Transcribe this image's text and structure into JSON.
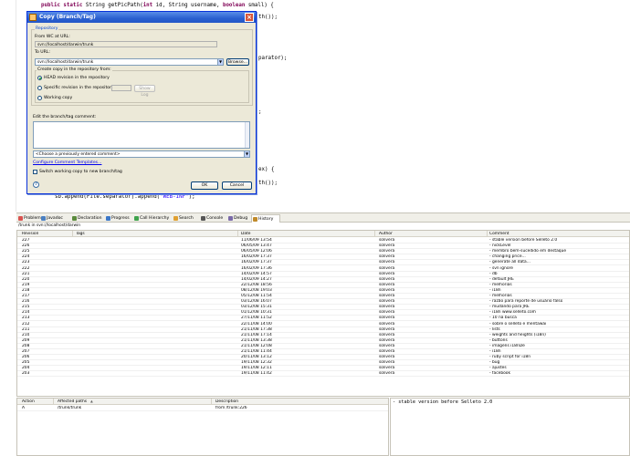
{
  "editor": {
    "lines": [
      {
        "segments": [
          {
            "t": "public static",
            "k": "kw"
          },
          {
            "t": " String getPicPath("
          },
          {
            "t": "int",
            "k": "kw"
          },
          {
            "t": " id, String username, "
          },
          {
            "t": "boolean",
            "k": "kw"
          },
          {
            "t": " small) {"
          }
        ]
      },
      {
        "segments": [
          {
            "t": "th());"
          }
        ]
      },
      {
        "segments": [
          {
            "t": "parator);"
          }
        ]
      },
      {
        "segments": [
          {
            "t": ";"
          }
        ]
      },
      {
        "segments": [
          {
            "t": "ex) {"
          }
        ]
      },
      {
        "segments": [
          {
            "t": "th());"
          }
        ]
      },
      {
        "segments": [
          {
            "t": "sb.append(File.separator).append("
          },
          {
            "t": "\"WEB-INF\"",
            "k": "str"
          },
          {
            "t": ");"
          }
        ]
      }
    ]
  },
  "dialog": {
    "title": "Copy (Branch/Tag)",
    "repository_group": "Repository",
    "from_label": "From WC at URL:",
    "from_value": "svn://localhost/darwin/trunk",
    "to_label": "To URL:",
    "to_value": "svn://localhost/darwin/trunk",
    "browse_label": "Browse...",
    "create_copy_label": "Create copy in the repository from:",
    "radio_head": "HEAD revision in the repository",
    "radio_specific": "Specific revision in the repository",
    "show_log_label": "Show Log",
    "radio_wc": "Working copy",
    "comment_label": "Edit the branch/tag comment:",
    "comment_value": "",
    "comment_select": "<Choose a previously entered comment>",
    "templates_link": "Configure Comment Templates...",
    "switch_label": "Switch working copy to new branch/tag",
    "ok_label": "OK",
    "cancel_label": "Cancel"
  },
  "views": {
    "tabs": [
      {
        "label": "Problems",
        "icon": "problems-icon",
        "color": "#d9534f"
      },
      {
        "label": "Javadoc",
        "icon": "javadoc-icon",
        "color": "#4a7fc1"
      },
      {
        "label": "Declaration",
        "icon": "declaration-icon",
        "color": "#5a8a3c"
      },
      {
        "label": "Progress",
        "icon": "progress-icon",
        "color": "#3c78c8"
      },
      {
        "label": "Call Hierarchy",
        "icon": "call-hierarchy-icon",
        "color": "#3fa34d"
      },
      {
        "label": "Search",
        "icon": "search-icon",
        "color": "#e0a030"
      },
      {
        "label": "Console",
        "icon": "console-icon",
        "color": "#555555"
      },
      {
        "label": "Debug",
        "icon": "debug-icon",
        "color": "#7a6aa8"
      },
      {
        "label": "History",
        "icon": "history-icon",
        "color": "#c08a2a",
        "active": true
      }
    ],
    "path": "/trunk in svn://localhost/darwin"
  },
  "history": {
    "headers": {
      "revision": "Revision",
      "tags": "Tags",
      "date": "Date",
      "author": "Author",
      "comment": "Comment"
    },
    "rows": [
      {
        "rev": "227",
        "date": "11/06/09 13:54",
        "author": "solivera",
        "comment": "- stable version before Selleto 2.0"
      },
      {
        "rev": "226",
        "date": "06/05/09 13:47",
        "author": "solivera",
        "comment": "- nickLevel"
      },
      {
        "rev": "225",
        "date": "06/05/09 12:06",
        "author": "solivera",
        "comment": "- membro bem-sucedido em destaque"
      },
      {
        "rev": "224",
        "date": "16/02/09 17:37",
        "author": "solivera",
        "comment": "- changing price..."
      },
      {
        "rev": "223",
        "date": "16/02/09 17:37",
        "author": "solivera",
        "comment": "- generate all data..."
      },
      {
        "rev": "222",
        "date": "16/02/09 17:36",
        "author": "solivera",
        "comment": "- svn ignore"
      },
      {
        "rev": "221",
        "date": "14/02/09 14:57",
        "author": "solivera",
        "comment": "- db"
      },
      {
        "rev": "220",
        "date": "14/02/09 14:27",
        "author": "solivera",
        "comment": "- default JRE"
      },
      {
        "rev": "219",
        "date": "22/12/08 18:56",
        "author": "solivera",
        "comment": "- melhorias"
      },
      {
        "rev": "218",
        "date": "08/12/08 19:03",
        "author": "solivera",
        "comment": "- i18n"
      },
      {
        "rev": "217",
        "date": "05/12/08 11:54",
        "author": "solivera",
        "comment": "- melhorias"
      },
      {
        "rev": "216",
        "date": "03/12/08 16:07",
        "author": "solivera",
        "comment": "- razão para reporte de usuário falso"
      },
      {
        "rev": "215",
        "date": "03/12/08 15:31",
        "author": "solivera",
        "comment": "- mudando para JRE"
      },
      {
        "rev": "214",
        "date": "01/12/08 10:31",
        "author": "solivera",
        "comment": "- i18n www.selleto.com"
      },
      {
        "rev": "213",
        "date": "27/11/08 11:52",
        "author": "solivera",
        "comment": "- 10 na busca"
      },
      {
        "rev": "212",
        "date": "22/11/08 14:00",
        "author": "solivera",
        "comment": "- sobre o selleto e mentawai"
      },
      {
        "rev": "211",
        "date": "21/11/08 17:38",
        "author": "solivera",
        "comment": "- lists"
      },
      {
        "rev": "210",
        "date": "21/11/08 17:14",
        "author": "solivera",
        "comment": "- weights and heights (i18n)"
      },
      {
        "rev": "209",
        "date": "21/11/08 13:38",
        "author": "solivera",
        "comment": "- buttons"
      },
      {
        "rev": "208",
        "date": "21/11/08 12:08",
        "author": "solivera",
        "comment": "- imagens i18nDe"
      },
      {
        "rev": "207",
        "date": "21/11/08 11:44",
        "author": "solivera",
        "comment": "- i18n"
      },
      {
        "rev": "206",
        "date": "20/11/08 13:12",
        "author": "solivera",
        "comment": "- ruby script for i18n"
      },
      {
        "rev": "205",
        "date": "19/11/08 12:32",
        "author": "solivera",
        "comment": "- bug"
      },
      {
        "rev": "204",
        "date": "19/11/08 12:11",
        "author": "solivera",
        "comment": "- ajustes"
      },
      {
        "rev": "203",
        "date": "19/11/08 11:42",
        "author": "solivera",
        "comment": "- facebook"
      }
    ]
  },
  "paths": {
    "headers": {
      "action": "Action",
      "path": "Affected paths",
      "description": "Description"
    },
    "sort_glyph": "▲",
    "rows": [
      {
        "action": "A",
        "path": "/trunk/trunk",
        "description": "from /trunk:226"
      }
    ]
  },
  "comment_pane": {
    "text": "- stable version before Selleto 2.0"
  }
}
